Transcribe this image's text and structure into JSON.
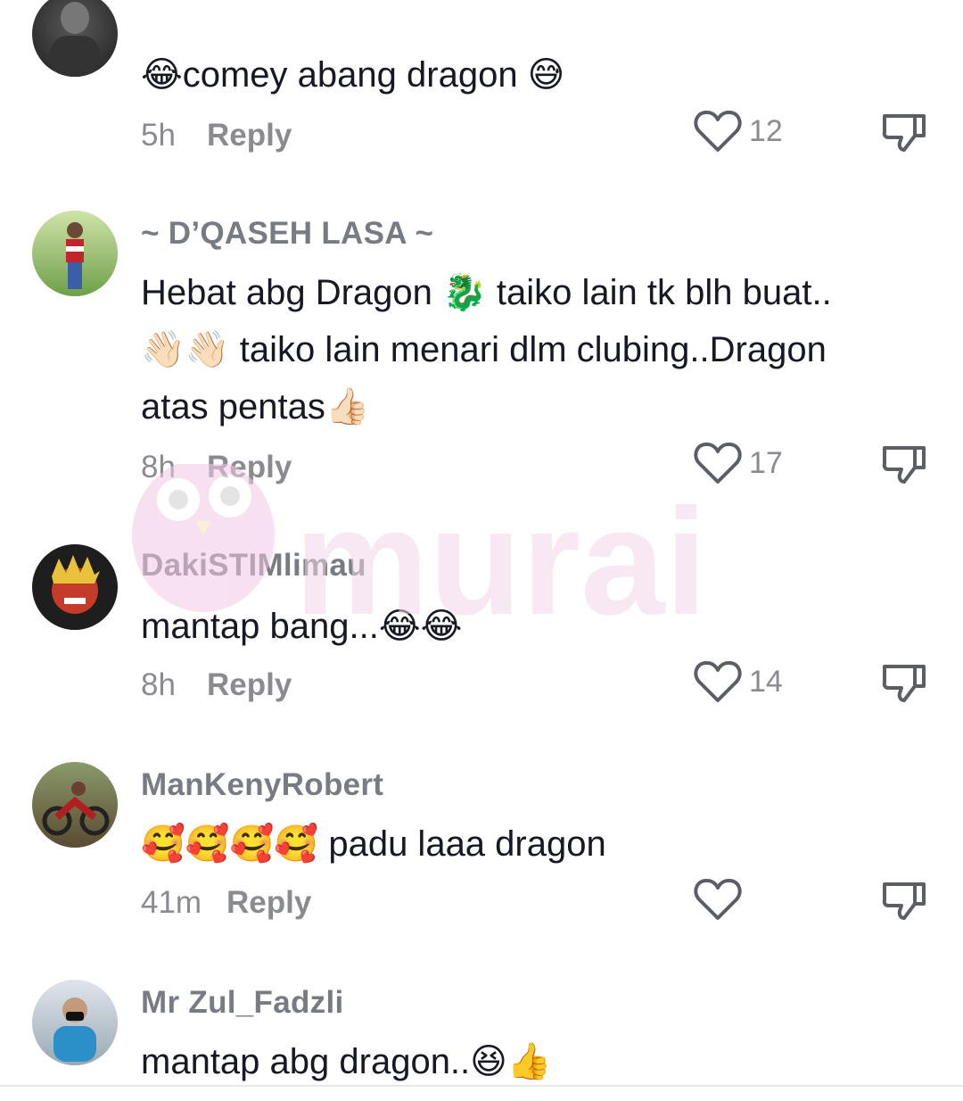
{
  "comments": [
    {
      "username": "",
      "text": "😂comey abang dragon 😅",
      "time": "5h",
      "reply": "Reply",
      "likes": "12"
    },
    {
      "username": "~ D’QASEH LASA ~",
      "text": "Hebat abg Dragon 🐉 taiko lain tk blh buat..\n👋🏻👋🏻 taiko lain menari dlm clubing..Dragon\natas pentas👍🏻",
      "time": "8h",
      "reply": "Reply",
      "likes": "17"
    },
    {
      "username": "DakiSTIMlimau",
      "text": "mantap bang...😂😂",
      "time": "8h",
      "reply": "Reply",
      "likes": "14"
    },
    {
      "username": "ManKenyRobert",
      "text": "🥰🥰🥰🥰 padu laaa dragon",
      "time": "41m",
      "reply": "Reply",
      "likes": ""
    },
    {
      "username": "Mr Zul_Fadzli",
      "text": "mantap abg dragon..😆👍",
      "time": "",
      "reply": "",
      "likes": ""
    }
  ],
  "watermark": {
    "text": "murai"
  },
  "icons": {
    "like": "heart-outline-icon",
    "dislike": "thumbs-down-outline-icon"
  }
}
